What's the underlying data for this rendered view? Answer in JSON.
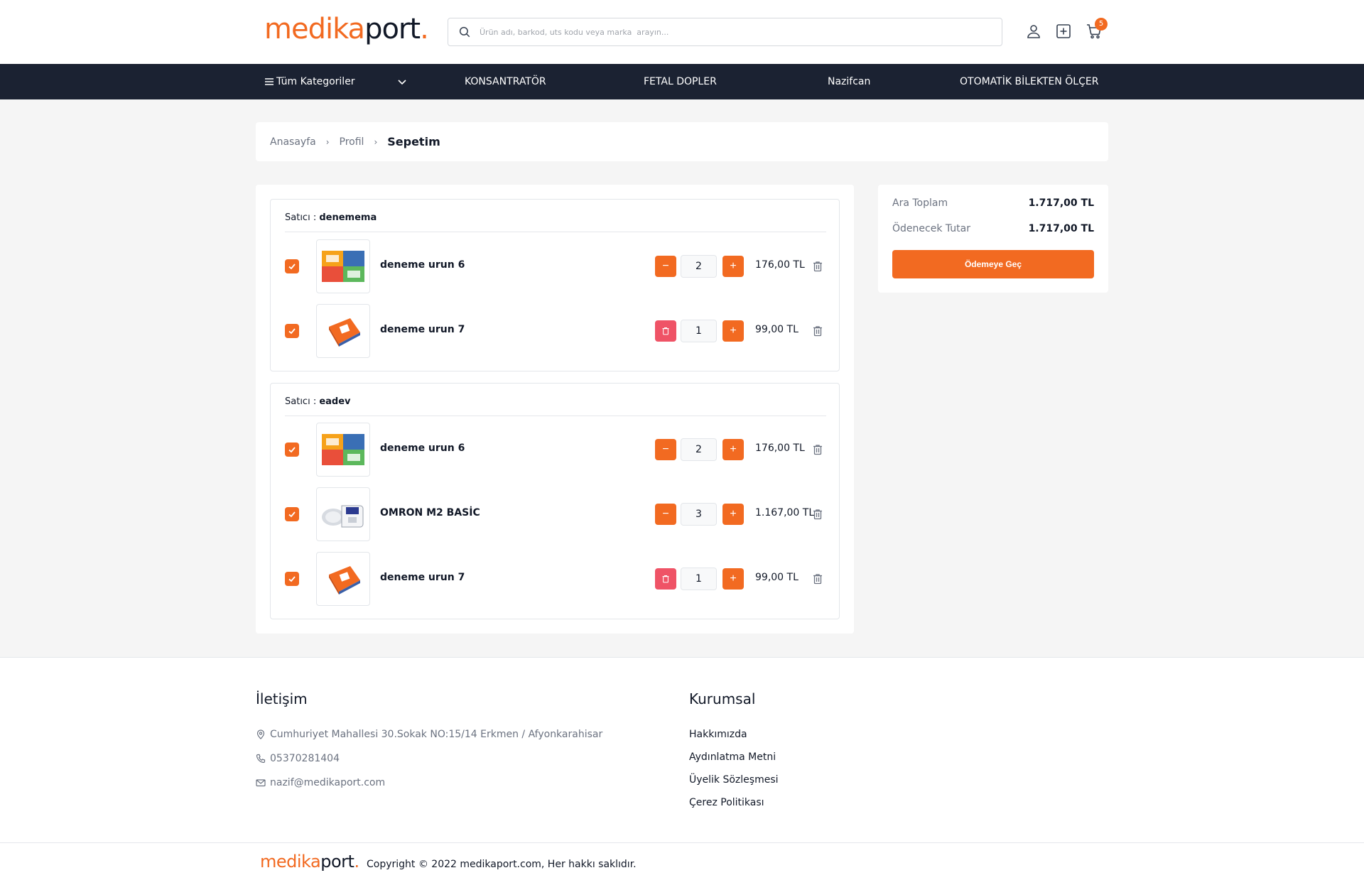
{
  "header": {
    "logo": {
      "part1": "medika",
      "part2": "port",
      "dot": "."
    },
    "search_placeholder": "Ürün adı, barkod, uts kodu veya marka  arayın...",
    "cart_count": "5"
  },
  "nav": {
    "categories_label": "Tüm Kategoriler",
    "items": [
      "KONSANTRATÖR",
      "FETAL DOPLER",
      "Nazifcan",
      "OTOMATİK BİLEKTEN ÖLÇER"
    ]
  },
  "breadcrumb": {
    "items": [
      "Anasayfa",
      "Profil"
    ],
    "current": "Sepetim"
  },
  "cart": {
    "seller_prefix": "Satıcı : ",
    "sellers": [
      {
        "name": "denemema",
        "items": [
          {
            "name": "deneme urun 6",
            "qty": "2",
            "price": "176,00 TL",
            "checked": true
          },
          {
            "name": "deneme urun 7",
            "qty": "1",
            "price": "99,00 TL",
            "checked": true
          }
        ]
      },
      {
        "name": "eadev",
        "items": [
          {
            "name": "deneme urun 6",
            "qty": "2",
            "price": "176,00 TL",
            "checked": true
          },
          {
            "name": "OMRON M2 BASİC",
            "qty": "3",
            "price": "1.167,00 TL",
            "checked": true
          },
          {
            "name": "deneme urun 7",
            "qty": "1",
            "price": "99,00 TL",
            "checked": true
          }
        ]
      }
    ]
  },
  "summary": {
    "subtotal_label": "Ara Toplam",
    "subtotal_value": "1.717,00 TL",
    "total_label": "Ödenecek Tutar",
    "total_value": "1.717,00 TL",
    "pay_button": "Ödemeye Geç"
  },
  "footer": {
    "contact_title": "İletişim",
    "address": "Cumhuriyet Mahallesi 30.Sokak NO:15/14 Erkmen / Afyonkarahisar",
    "phone": "05370281404",
    "email": "nazif@medikaport.com",
    "corporate_title": "Kurumsal",
    "links": [
      "Hakkımızda",
      "Aydınlatma Metni",
      "Üyelik Sözleşmesi",
      "Çerez Politikası"
    ],
    "copyright": "Copyright © 2022 medikaport.com, Her hakkı saklıdır."
  },
  "colors": {
    "accent": "#f26a21",
    "nav_bg": "#1b2232",
    "danger": "#ef5366"
  }
}
